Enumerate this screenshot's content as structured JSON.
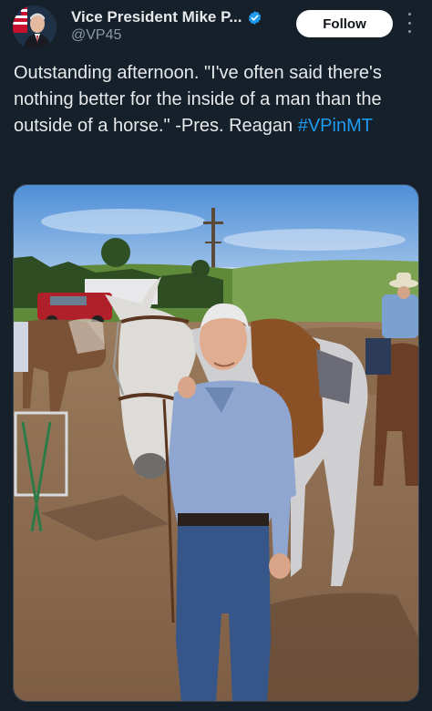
{
  "post": {
    "author": {
      "display_name": "Vice President Mike P...",
      "handle": "@VP45",
      "verified_icon": "verified-badge-icon",
      "avatar": "avatar-photo"
    },
    "follow_label": "Follow",
    "more_icon": "more-options-icon",
    "text": "Outstanding afternoon. \"I've often said there's nothing better for the inside of a man than the outside of a horse.\" -Pres. Reagan ",
    "hashtag": "#VPinMT",
    "media": {
      "icon": "photo-image"
    }
  },
  "colors": {
    "background": "#15202b",
    "accent": "#1d9bf0",
    "text": "#e7e9ea",
    "secondary_text": "#8b98a5"
  }
}
